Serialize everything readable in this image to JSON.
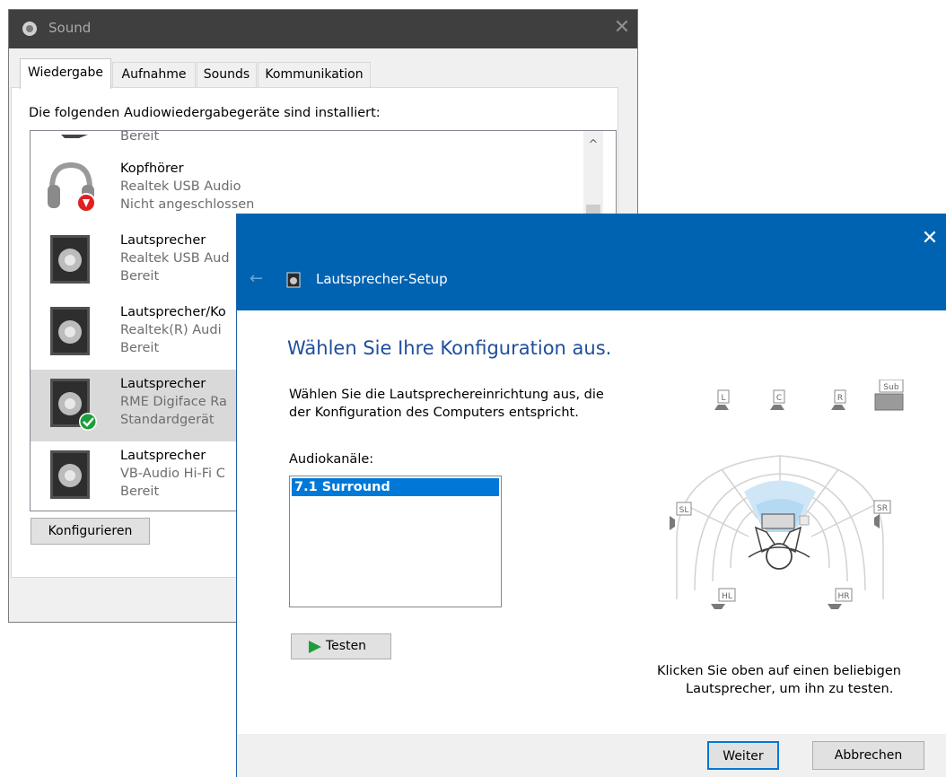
{
  "sound_window": {
    "title": "Sound",
    "tabs": [
      "Wiedergabe",
      "Aufnahme",
      "Sounds",
      "Kommunikation"
    ],
    "active_tab": "Wiedergabe",
    "heading": "Die folgenden Audiowiedergabegeräte sind installiert:",
    "devices": [
      {
        "name": "",
        "line2": "",
        "line3": "Bereit"
      },
      {
        "name": "Kopfhörer",
        "line2": "Realtek USB Audio",
        "line3": "Nicht angeschlossen"
      },
      {
        "name": "Lautsprecher",
        "line2": "Realtek USB Aud",
        "line3": "Bereit"
      },
      {
        "name": "Lautsprecher/Ko",
        "line2": "Realtek(R) Audi",
        "line3": "Bereit"
      },
      {
        "name": "Lautsprecher",
        "line2": "RME Digiface Ra",
        "line3": "Standardgerät"
      },
      {
        "name": "Lautsprecher",
        "line2": "VB-Audio Hi-Fi C",
        "line3": "Bereit"
      }
    ],
    "scroll_up_glyph": "^",
    "configure_button": "Konfigurieren",
    "close_glyph": "✕"
  },
  "setup_dialog": {
    "title": "Lautsprecher-Setup",
    "heading": "Wählen Sie Ihre Konfiguration aus.",
    "description_line1": "Wählen Sie die Lautsprechereinrichtung aus, die",
    "description_line2": "der Konfiguration des Computers entspricht.",
    "channels_label": "Audiokanäle:",
    "selected_channel": "7.1 Surround",
    "test_button": "Testen",
    "hint_line1": "Klicken Sie oben auf einen beliebigen",
    "hint_line2": "Lautsprecher, um ihn zu testen.",
    "next_button": "Weiter",
    "cancel_button": "Abbrechen",
    "close_glyph": "✕",
    "back_glyph": "←",
    "speakers": {
      "l": "L",
      "c": "C",
      "r": "R",
      "sub": "Sub",
      "sl": "SL",
      "sr": "SR",
      "hl": "HL",
      "hr": "HR"
    }
  },
  "colors": {
    "accent": "#0063b1",
    "selection": "#0078d7",
    "heading": "#1f4e9c",
    "titlebar_dark": "#3f3f3f",
    "default_check": "#1e9e3a",
    "disconnected": "#e02020"
  }
}
